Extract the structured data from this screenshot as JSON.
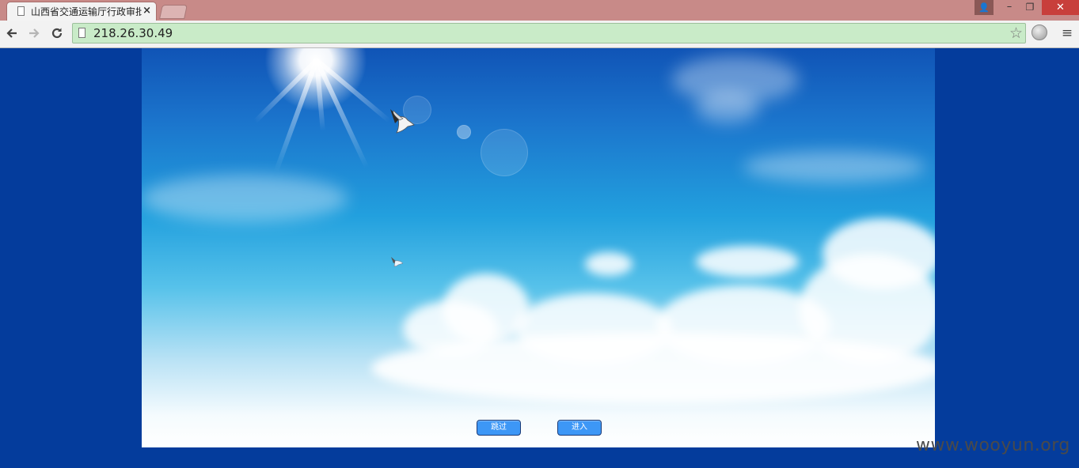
{
  "browser": {
    "tab_title": "山西省交通运输厅行政审批",
    "tab_close": "×",
    "url": "218.26.30.49",
    "icons": [
      "back-icon",
      "forward-icon",
      "reload-icon",
      "page-icon",
      "star-icon",
      "globe-icon",
      "menu-icon",
      "user-icon"
    ]
  },
  "window_controls": {
    "minimize": "–",
    "restore": "❐",
    "close": "✕",
    "user": "👤"
  },
  "page": {
    "skip_button": "跳过",
    "enter_button": "进入"
  },
  "watermark": "www.wooyun.org",
  "colors": {
    "background": "#043c9c",
    "button": "#3d97f6",
    "omnibox": "#c9ebc8",
    "titlebar": "#c88a88"
  }
}
